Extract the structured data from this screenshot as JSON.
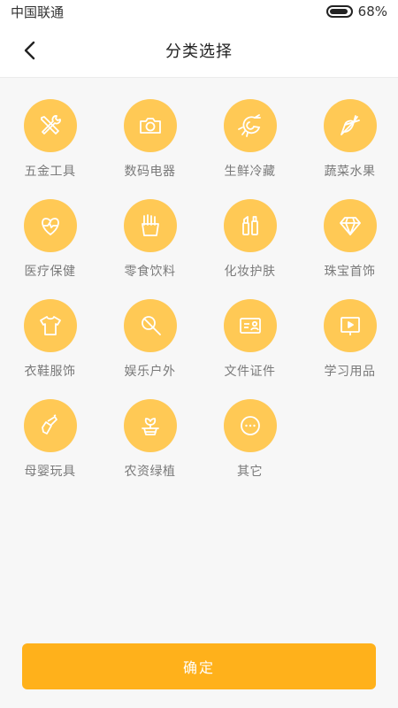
{
  "status_bar": {
    "carrier": "中国联通",
    "battery": "68%"
  },
  "header": {
    "title": "分类选择",
    "back_icon": "chevron-left-icon"
  },
  "categories": [
    {
      "label": "五金工具",
      "icon": "tools-icon"
    },
    {
      "label": "数码电器",
      "icon": "camera-icon"
    },
    {
      "label": "生鲜冷藏",
      "icon": "shrimp-icon"
    },
    {
      "label": "蔬菜水果",
      "icon": "carrot-icon"
    },
    {
      "label": "医疗保健",
      "icon": "heart-pulse-icon"
    },
    {
      "label": "零食饮料",
      "icon": "fries-icon"
    },
    {
      "label": "化妆护肤",
      "icon": "cosmetics-icon"
    },
    {
      "label": "珠宝首饰",
      "icon": "diamond-icon"
    },
    {
      "label": "衣鞋服饰",
      "icon": "tshirt-icon"
    },
    {
      "label": "娱乐户外",
      "icon": "microphone-icon"
    },
    {
      "label": "文件证件",
      "icon": "id-card-icon"
    },
    {
      "label": "学习用品",
      "icon": "presentation-icon"
    },
    {
      "label": "母婴玩具",
      "icon": "baby-bottle-icon"
    },
    {
      "label": "农资绿植",
      "icon": "potted-plant-icon"
    },
    {
      "label": "其它",
      "icon": "more-icon"
    }
  ],
  "confirm_button": {
    "label": "确定"
  },
  "colors": {
    "icon_bg": "#ffc955",
    "button_bg": "#ffb11b",
    "label_text": "#7a7a7a"
  }
}
